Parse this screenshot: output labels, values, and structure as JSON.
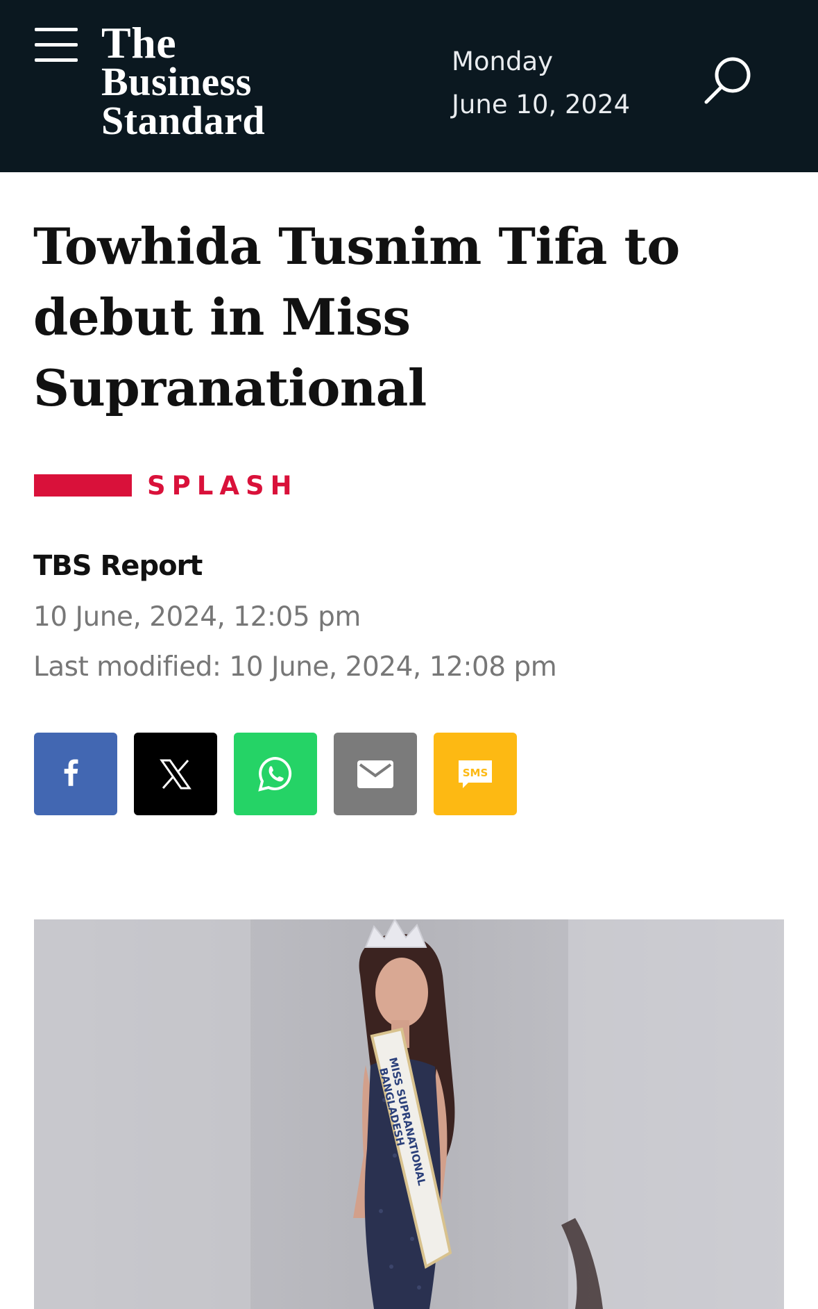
{
  "header": {
    "logo_lines": [
      "The",
      "Business",
      "Standard"
    ],
    "date": {
      "weekday": "Monday",
      "full_date": "June 10, 2024"
    },
    "menu_icon": "hamburger-menu-icon",
    "search_icon": "search-icon",
    "background": "#0b1820"
  },
  "article": {
    "headline": "Towhida Tusnim Tifa to debut in Miss Supranational",
    "section": {
      "label": "SPLASH",
      "color": "#d9113a"
    },
    "author": "TBS Report",
    "published": "10 June, 2024, 12:05 pm",
    "last_modified": "Last modified: 10 June, 2024, 12:08 pm"
  },
  "share": [
    {
      "icon": "facebook-icon",
      "color": "#4267b2"
    },
    {
      "icon": "x-icon",
      "color": "#000000"
    },
    {
      "icon": "whatsapp-icon",
      "color": "#25d366"
    },
    {
      "icon": "email-icon",
      "color": "#7b7b7b"
    },
    {
      "icon": "sms-icon",
      "color": "#fdb913",
      "label": "SMS"
    }
  ],
  "hero_image": {
    "sash_lines": [
      "MISS SUPRANATIONAL",
      "BANGLADESH"
    ]
  }
}
